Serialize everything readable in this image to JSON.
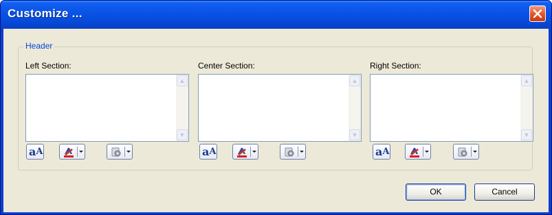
{
  "window": {
    "title": "Customize ...",
    "close_icon": "close-icon"
  },
  "header_group": {
    "legend": "Header",
    "sections": [
      {
        "label": "Left Section:",
        "value": ""
      },
      {
        "label": "Center Section:",
        "value": ""
      },
      {
        "label": "Right Section:",
        "value": ""
      }
    ],
    "tool_icons": [
      "font-icon",
      "text-color-icon",
      "insert-image-icon"
    ]
  },
  "buttons": {
    "ok": "OK",
    "cancel": "Cancel"
  },
  "colors": {
    "title_bar": "#0a54e8",
    "client_bg": "#ece9d8",
    "legend_text": "#0046d5",
    "close_button": "#e0542a"
  }
}
